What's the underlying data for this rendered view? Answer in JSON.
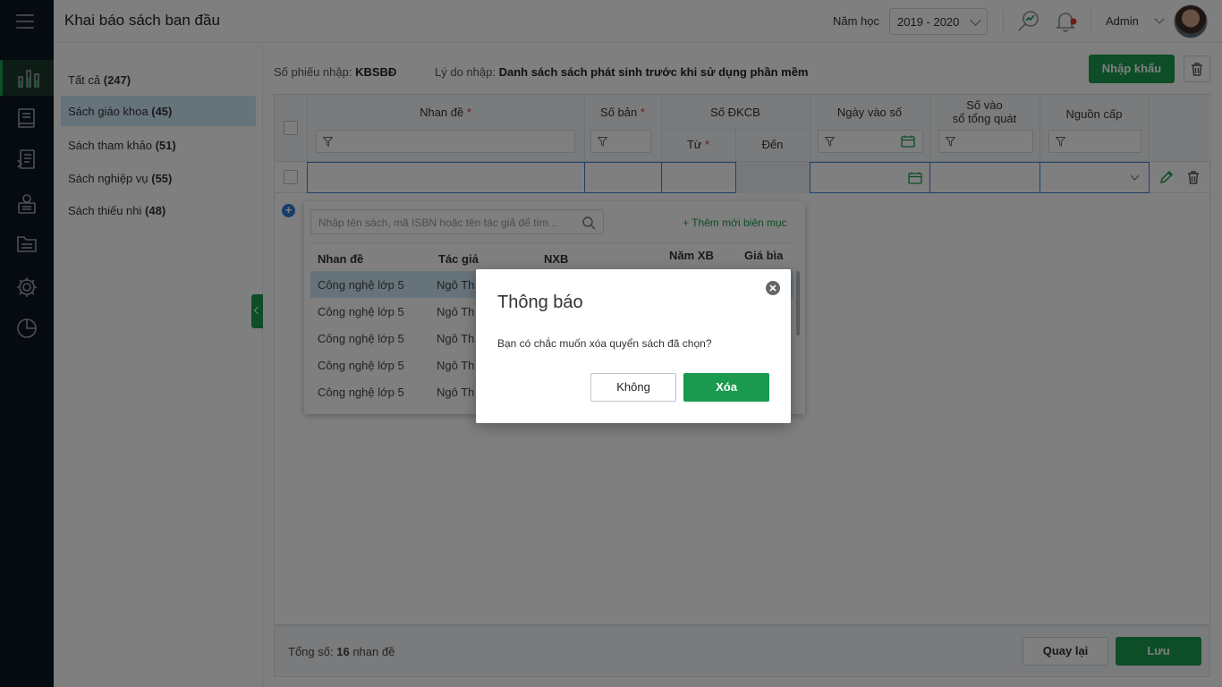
{
  "header": {
    "title": "Khai báo sách ban đầu",
    "year_label": "Năm học",
    "year_value": "2019 - 2020",
    "user_name": "Admin"
  },
  "sidebar": {
    "icons": [
      "menu-icon",
      "dashboard-chart-icon",
      "book-icon",
      "book-list-icon",
      "library-icon",
      "folder-icon",
      "settings-icon",
      "pie-chart-icon"
    ]
  },
  "categories": [
    {
      "name": "Tất cả",
      "count": "(247)"
    },
    {
      "name": "Sách giáo khoa",
      "count": "(45)"
    },
    {
      "name": "Sách tham khảo",
      "count": "(51)"
    },
    {
      "name": "Sách nghiệp vụ",
      "count": "(55)"
    },
    {
      "name": "Sách thiếu nhi",
      "count": "(48)"
    }
  ],
  "meta": {
    "receipt_label": "Số phiếu nhập:",
    "receipt_value": "KBSBĐ",
    "reason_label": "Lý do nhập:",
    "reason_value": "Danh sách sách phát sinh trước khi sử dụng phần mềm"
  },
  "buttons": {
    "import": "Nhập khẩu",
    "back": "Quay lại",
    "save": "Lưu"
  },
  "grid": {
    "col_title": "Nhan đề",
    "col_copies": "Số bản",
    "col_dkcb": "Số ĐKCB",
    "col_from": "Từ",
    "col_to": "Đến",
    "col_date": "Ngày vào số",
    "col_general_1": "Số vào",
    "col_general_2": "sổ tổng quát",
    "col_source": "Nguồn cấp",
    "required_mark": "*"
  },
  "dropdown": {
    "search_placeholder": "Nhập tên sách, mã ISBN hoặc tên tác giả để tìm...",
    "add_new": "Thêm mới biên mục",
    "headers": {
      "title": "Nhan đề",
      "author": "Tác giả",
      "publisher": "NXB",
      "year": "Năm XB",
      "price": "Giá bìa"
    },
    "rows": [
      {
        "title": "Công nghệ lớp 5",
        "author": "Ngô Th"
      },
      {
        "title": "Công nghệ lớp 5",
        "author": "Ngô Th"
      },
      {
        "title": "Công nghệ lớp 5",
        "author": "Ngô Th"
      },
      {
        "title": "Công nghệ lớp 5",
        "author": "Ngô Th"
      },
      {
        "title": "Công nghệ lớp 5",
        "author": "Ngô Th"
      }
    ]
  },
  "footer": {
    "total_label": "Tổng số:",
    "total_value": "16",
    "total_unit": "nhan đề"
  },
  "dialog": {
    "title": "Thông báo",
    "message": "Bạn có chắc muốn xóa quyển sách đã chọn?",
    "no_label": "Không",
    "yes_label": "Xóa"
  },
  "colors": {
    "brand_green": "#1a9a4f",
    "sidebar_bg": "#0c1625",
    "selected_row": "#cfe6f7",
    "accent_blue": "#3b82d6"
  }
}
